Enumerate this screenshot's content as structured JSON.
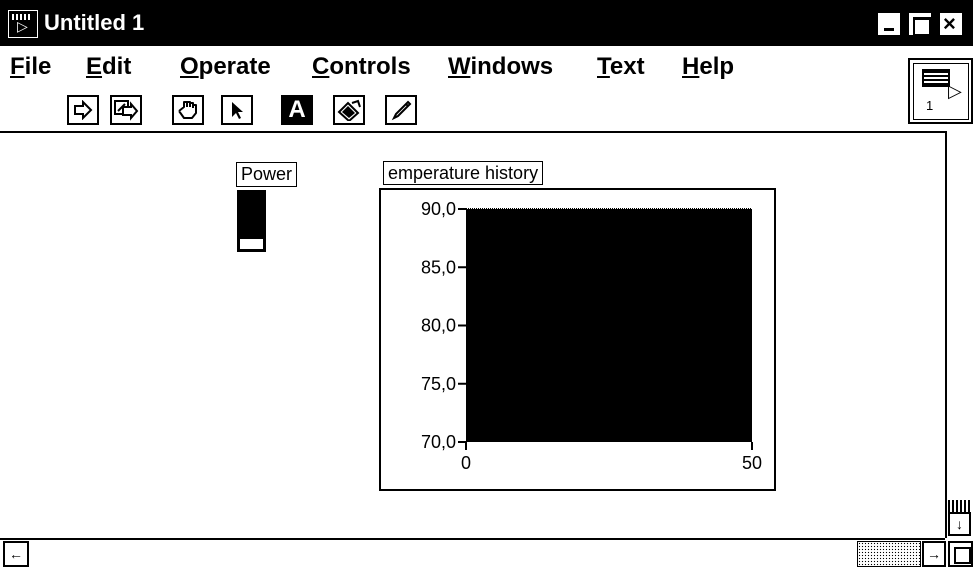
{
  "window": {
    "title": "Untitled 1",
    "app_icon_glyph": "▷",
    "close_glyph": "×"
  },
  "menubar": {
    "items": [
      {
        "key": "F",
        "rest": "ile"
      },
      {
        "key": "E",
        "rest": "dit"
      },
      {
        "key": "O",
        "rest": "perate"
      },
      {
        "key": "C",
        "rest": "ontrols"
      },
      {
        "key": "W",
        "rest": "indows"
      },
      {
        "key": "T",
        "rest": "ext"
      },
      {
        "key": "H",
        "rest": "elp"
      }
    ]
  },
  "connector_pane": {
    "number": "1",
    "arrow_glyph": "▷"
  },
  "toolbar": {
    "tools": [
      "operate-arrow-icon",
      "continuous-run-icon",
      "operating-hand-icon",
      "positioning-arrow-icon",
      "labeling-text-icon",
      "coloring-brush-icon",
      "pen-icon"
    ],
    "text_tool_glyph": "A"
  },
  "panel": {
    "power": {
      "label": "Power"
    },
    "chart": {
      "label": "emperature history"
    }
  },
  "scrollbars": {
    "left_glyph": "←",
    "right_glyph": "→",
    "down_glyph": "↓"
  },
  "colors": {
    "titlebar": "#000000",
    "background": "#ffffff",
    "chart_plot": "#000000"
  },
  "chart_data": {
    "type": "line",
    "title": "emperature history",
    "xlabel": "",
    "ylabel": "",
    "xlim": [
      0,
      50
    ],
    "ylim": [
      70.0,
      90.0
    ],
    "x_ticks": [
      "0",
      "50"
    ],
    "y_ticks": [
      "90,0",
      "85,0",
      "80,0",
      "75,0",
      "70,0"
    ],
    "y_tick_values": [
      90,
      85,
      80,
      75,
      70
    ],
    "x_tick_values": [
      0,
      50
    ],
    "series": [],
    "grid": false,
    "plot_background": "#000000"
  }
}
